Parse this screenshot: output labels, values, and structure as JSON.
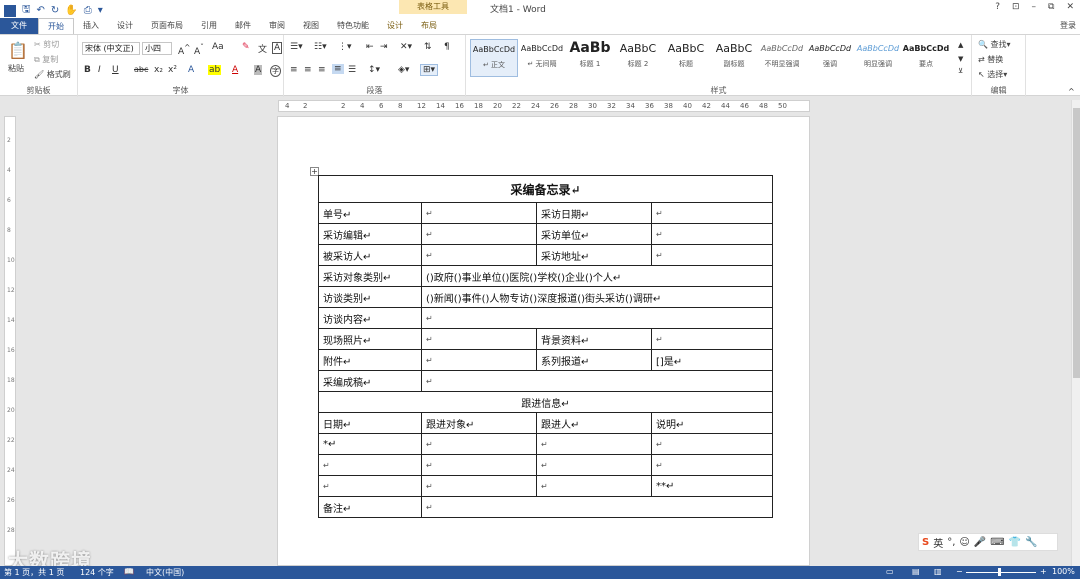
{
  "window": {
    "title": "文档1 - Word",
    "context_tab": "表格工具",
    "controls": [
      "?",
      "⊡",
      "–",
      "⧉",
      "✕"
    ],
    "login": "登录"
  },
  "tabs": [
    {
      "label": "文件"
    },
    {
      "label": "开始"
    },
    {
      "label": "插入"
    },
    {
      "label": "设计"
    },
    {
      "label": "页面布局"
    },
    {
      "label": "引用"
    },
    {
      "label": "邮件"
    },
    {
      "label": "审阅"
    },
    {
      "label": "视图"
    },
    {
      "label": "特色功能"
    },
    {
      "label": "设计"
    },
    {
      "label": "布局"
    }
  ],
  "clipboard": {
    "paste": "粘贴",
    "cut": "剪切",
    "copy": "复制",
    "format_painter": "格式刷",
    "label": "剪贴板"
  },
  "font": {
    "name": "宋体 (中文正)",
    "size": "小四",
    "label": "字体"
  },
  "paragraph": {
    "label": "段落"
  },
  "styles": {
    "label": "样式",
    "items": [
      {
        "preview": "AaBbCcDd",
        "name": "↵ 正文"
      },
      {
        "preview": "AaBbCcDd",
        "name": "↵ 无间隔"
      },
      {
        "preview": "AaBb",
        "name": "标题 1"
      },
      {
        "preview": "AaBbC",
        "name": "标题 2"
      },
      {
        "preview": "AaBbC",
        "name": "标题"
      },
      {
        "preview": "AaBbC",
        "name": "副标题"
      },
      {
        "preview": "AaBbCcDd",
        "name": "不明显强调"
      },
      {
        "preview": "AaBbCcDd",
        "name": "强调"
      },
      {
        "preview": "AaBbCcDd",
        "name": "明显强调"
      },
      {
        "preview": "AaBbCcDd",
        "name": "要点"
      }
    ]
  },
  "editing": {
    "find": "查找",
    "replace": "替换",
    "select": "选择",
    "label": "编辑"
  },
  "ruler": {
    "ticks": [
      "4",
      "2",
      "2",
      "4",
      "6",
      "8",
      "12",
      "14",
      "16",
      "18",
      "20",
      "22",
      "24",
      "26",
      "28",
      "30",
      "32",
      "34",
      "36",
      "38",
      "40",
      "42",
      "44",
      "46",
      "48",
      "50"
    ]
  },
  "vruler": {
    "ticks": [
      "2",
      "4",
      "6",
      "8",
      "10",
      "12",
      "14",
      "16",
      "18",
      "20",
      "22",
      "24",
      "26",
      "28"
    ]
  },
  "table": {
    "title": "采编备忘录↵",
    "rows": [
      [
        "单号↵",
        "↵",
        "采访日期↵",
        "↵"
      ],
      [
        "采访编辑↵",
        "↵",
        "采访单位↵",
        "↵"
      ],
      [
        "被采访人↵",
        "↵",
        "采访地址↵",
        "↵"
      ]
    ],
    "type_row": {
      "label": "采访对象类别↵",
      "value": "()政府()事业单位()医院()学校()企业()个人↵"
    },
    "interview_type": {
      "label": "访谈类别↵",
      "value": "()新闻()事件()人物专访()深度报道()街头采访()调研↵"
    },
    "content": {
      "label": "访谈内容↵",
      "value": "↵"
    },
    "rows2": [
      [
        "现场照片↵",
        "↵",
        "背景资料↵",
        "↵"
      ],
      [
        "附件↵",
        "↵",
        "系列报道↵",
        "[]是↵"
      ]
    ],
    "draft": {
      "label": "采编成稿↵",
      "value": "↵"
    },
    "followup_title": "跟进信息↵",
    "followup_header": [
      "日期↵",
      "跟进对象↵",
      "跟进人↵",
      "说明↵"
    ],
    "followup_rows": [
      [
        "*↵",
        "↵",
        "↵",
        "↵"
      ],
      [
        "↵",
        "↵",
        "↵",
        "↵"
      ],
      [
        "↵",
        "↵",
        "↵",
        "**↵"
      ]
    ],
    "remark": {
      "label": "备注↵",
      "value": "↵"
    }
  },
  "status": {
    "page": "第 1 页，共 1 页",
    "words": "124 个字",
    "lang": "中文(中国)",
    "zoom": "100%"
  },
  "ime": {
    "label": "英"
  },
  "watermark": "大数跨境"
}
